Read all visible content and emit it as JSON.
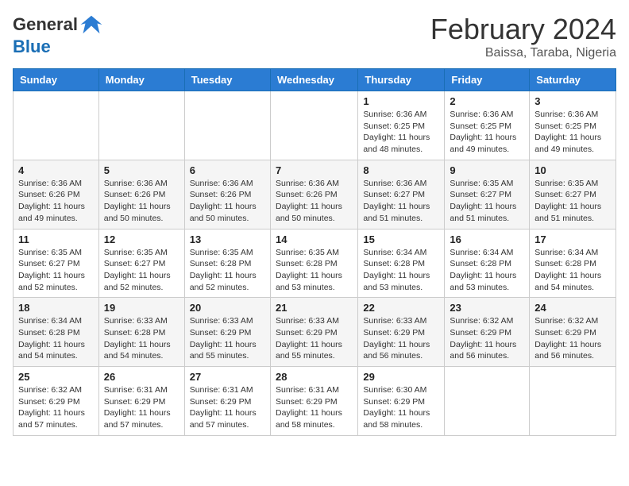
{
  "header": {
    "logo_general": "General",
    "logo_blue": "Blue",
    "month_title": "February 2024",
    "subtitle": "Baissa, Taraba, Nigeria"
  },
  "days_of_week": [
    "Sunday",
    "Monday",
    "Tuesday",
    "Wednesday",
    "Thursday",
    "Friday",
    "Saturday"
  ],
  "weeks": [
    [
      {
        "day": "",
        "info": ""
      },
      {
        "day": "",
        "info": ""
      },
      {
        "day": "",
        "info": ""
      },
      {
        "day": "",
        "info": ""
      },
      {
        "day": "1",
        "info": "Sunrise: 6:36 AM\nSunset: 6:25 PM\nDaylight: 11 hours\nand 48 minutes."
      },
      {
        "day": "2",
        "info": "Sunrise: 6:36 AM\nSunset: 6:25 PM\nDaylight: 11 hours\nand 49 minutes."
      },
      {
        "day": "3",
        "info": "Sunrise: 6:36 AM\nSunset: 6:25 PM\nDaylight: 11 hours\nand 49 minutes."
      }
    ],
    [
      {
        "day": "4",
        "info": "Sunrise: 6:36 AM\nSunset: 6:26 PM\nDaylight: 11 hours\nand 49 minutes."
      },
      {
        "day": "5",
        "info": "Sunrise: 6:36 AM\nSunset: 6:26 PM\nDaylight: 11 hours\nand 50 minutes."
      },
      {
        "day": "6",
        "info": "Sunrise: 6:36 AM\nSunset: 6:26 PM\nDaylight: 11 hours\nand 50 minutes."
      },
      {
        "day": "7",
        "info": "Sunrise: 6:36 AM\nSunset: 6:26 PM\nDaylight: 11 hours\nand 50 minutes."
      },
      {
        "day": "8",
        "info": "Sunrise: 6:36 AM\nSunset: 6:27 PM\nDaylight: 11 hours\nand 51 minutes."
      },
      {
        "day": "9",
        "info": "Sunrise: 6:35 AM\nSunset: 6:27 PM\nDaylight: 11 hours\nand 51 minutes."
      },
      {
        "day": "10",
        "info": "Sunrise: 6:35 AM\nSunset: 6:27 PM\nDaylight: 11 hours\nand 51 minutes."
      }
    ],
    [
      {
        "day": "11",
        "info": "Sunrise: 6:35 AM\nSunset: 6:27 PM\nDaylight: 11 hours\nand 52 minutes."
      },
      {
        "day": "12",
        "info": "Sunrise: 6:35 AM\nSunset: 6:27 PM\nDaylight: 11 hours\nand 52 minutes."
      },
      {
        "day": "13",
        "info": "Sunrise: 6:35 AM\nSunset: 6:28 PM\nDaylight: 11 hours\nand 52 minutes."
      },
      {
        "day": "14",
        "info": "Sunrise: 6:35 AM\nSunset: 6:28 PM\nDaylight: 11 hours\nand 53 minutes."
      },
      {
        "day": "15",
        "info": "Sunrise: 6:34 AM\nSunset: 6:28 PM\nDaylight: 11 hours\nand 53 minutes."
      },
      {
        "day": "16",
        "info": "Sunrise: 6:34 AM\nSunset: 6:28 PM\nDaylight: 11 hours\nand 53 minutes."
      },
      {
        "day": "17",
        "info": "Sunrise: 6:34 AM\nSunset: 6:28 PM\nDaylight: 11 hours\nand 54 minutes."
      }
    ],
    [
      {
        "day": "18",
        "info": "Sunrise: 6:34 AM\nSunset: 6:28 PM\nDaylight: 11 hours\nand 54 minutes."
      },
      {
        "day": "19",
        "info": "Sunrise: 6:33 AM\nSunset: 6:28 PM\nDaylight: 11 hours\nand 54 minutes."
      },
      {
        "day": "20",
        "info": "Sunrise: 6:33 AM\nSunset: 6:29 PM\nDaylight: 11 hours\nand 55 minutes."
      },
      {
        "day": "21",
        "info": "Sunrise: 6:33 AM\nSunset: 6:29 PM\nDaylight: 11 hours\nand 55 minutes."
      },
      {
        "day": "22",
        "info": "Sunrise: 6:33 AM\nSunset: 6:29 PM\nDaylight: 11 hours\nand 56 minutes."
      },
      {
        "day": "23",
        "info": "Sunrise: 6:32 AM\nSunset: 6:29 PM\nDaylight: 11 hours\nand 56 minutes."
      },
      {
        "day": "24",
        "info": "Sunrise: 6:32 AM\nSunset: 6:29 PM\nDaylight: 11 hours\nand 56 minutes."
      }
    ],
    [
      {
        "day": "25",
        "info": "Sunrise: 6:32 AM\nSunset: 6:29 PM\nDaylight: 11 hours\nand 57 minutes."
      },
      {
        "day": "26",
        "info": "Sunrise: 6:31 AM\nSunset: 6:29 PM\nDaylight: 11 hours\nand 57 minutes."
      },
      {
        "day": "27",
        "info": "Sunrise: 6:31 AM\nSunset: 6:29 PM\nDaylight: 11 hours\nand 57 minutes."
      },
      {
        "day": "28",
        "info": "Sunrise: 6:31 AM\nSunset: 6:29 PM\nDaylight: 11 hours\nand 58 minutes."
      },
      {
        "day": "29",
        "info": "Sunrise: 6:30 AM\nSunset: 6:29 PM\nDaylight: 11 hours\nand 58 minutes."
      },
      {
        "day": "",
        "info": ""
      },
      {
        "day": "",
        "info": ""
      }
    ]
  ]
}
